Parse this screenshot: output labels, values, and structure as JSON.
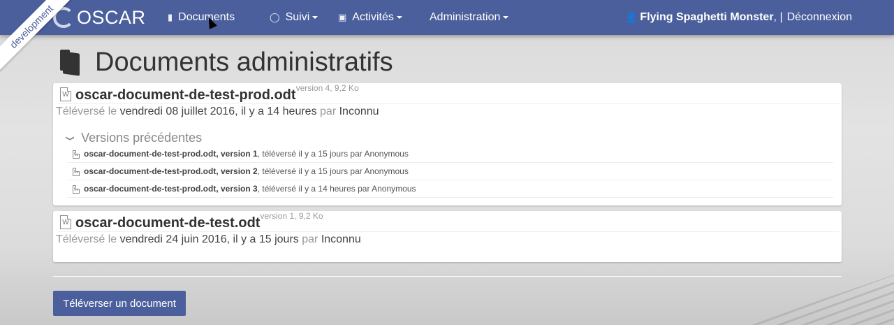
{
  "env_ribbon": "development",
  "brand": "OSCAR",
  "nav": {
    "items": [
      {
        "label": "Documents",
        "icon": "book-icon"
      },
      {
        "label": "Suivi",
        "icon": "watch-icon"
      },
      {
        "label": "Activités",
        "icon": "cube-icon"
      },
      {
        "label": "Administration",
        "icon": ""
      }
    ],
    "user_name": "Flying Spaghetti Monster",
    "user_sep": ", |",
    "logout": "Déconnexion"
  },
  "page": {
    "title": "Documents administratifs"
  },
  "documents": [
    {
      "name": "oscar-document-de-test-prod.odt",
      "meta": "version 4, 9,2 Ko",
      "uploaded_label": "Téléversé le",
      "uploaded_date": "vendredi 08 juillet 2016, il y a 14 heures",
      "by_label": "par",
      "author": "Inconnu",
      "versions_title": "Versions précédentes",
      "versions": [
        {
          "name": "oscar-document-de-test-prod.odt, version 1",
          "detail": ", téléversé il y a 15 jours par Anonymous"
        },
        {
          "name": "oscar-document-de-test-prod.odt, version 2",
          "detail": ", téléversé il y a 15 jours par Anonymous"
        },
        {
          "name": "oscar-document-de-test-prod.odt, version 3",
          "detail": ", téléversé il y a 14 heures par Anonymous"
        }
      ]
    },
    {
      "name": "oscar-document-de-test.odt",
      "meta": "version 1, 9,2 Ko",
      "uploaded_label": "Téléversé le",
      "uploaded_date": "vendredi 24 juin 2016, il y a 15 jours",
      "by_label": "par",
      "author": "Inconnu"
    }
  ],
  "upload_button": "Téléverser un document",
  "colors": {
    "navbar": "#4a5f9c",
    "button": "#4a5f9c"
  }
}
